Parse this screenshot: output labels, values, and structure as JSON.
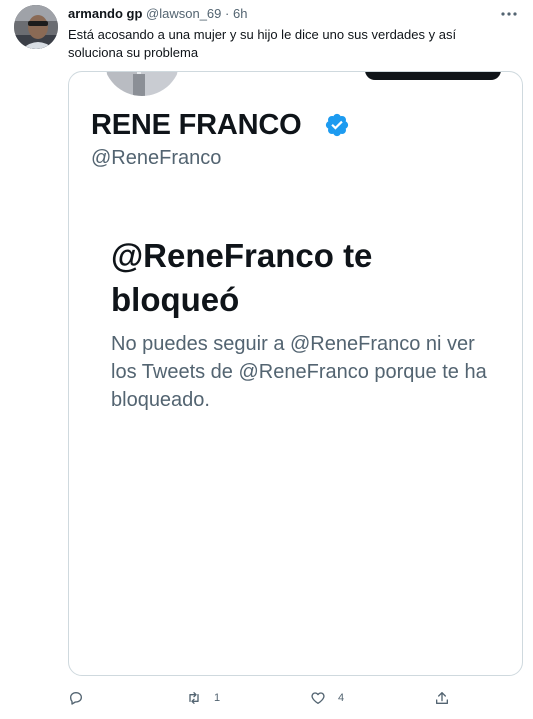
{
  "tweet": {
    "author_name": "armando gp",
    "author_handle": "@lawson_69",
    "separator": "·",
    "time": "6h",
    "text": "Está acosando a una mujer y su hijo le dice uno sus verdades y así soluciona su problema"
  },
  "media": {
    "profile_name": "RENE FRANCO",
    "profile_handle": "@ReneFranco",
    "blocked_title": "@ReneFranco te bloqueó",
    "blocked_description": "No puedes seguir a @ReneFranco ni ver los Tweets de @ReneFranco porque te ha bloqueado."
  },
  "actions": {
    "reply_count": "",
    "retweet_count": "1",
    "like_count": "4"
  },
  "colors": {
    "text_primary": "#0f1419",
    "text_secondary": "#536471",
    "border": "#cfd9de",
    "verified": "#1d9bf0"
  },
  "icons": {
    "more": "more-horizontal-icon",
    "verified": "verified-badge-icon",
    "reply": "reply-icon",
    "retweet": "retweet-icon",
    "like": "heart-icon",
    "share": "share-icon"
  }
}
